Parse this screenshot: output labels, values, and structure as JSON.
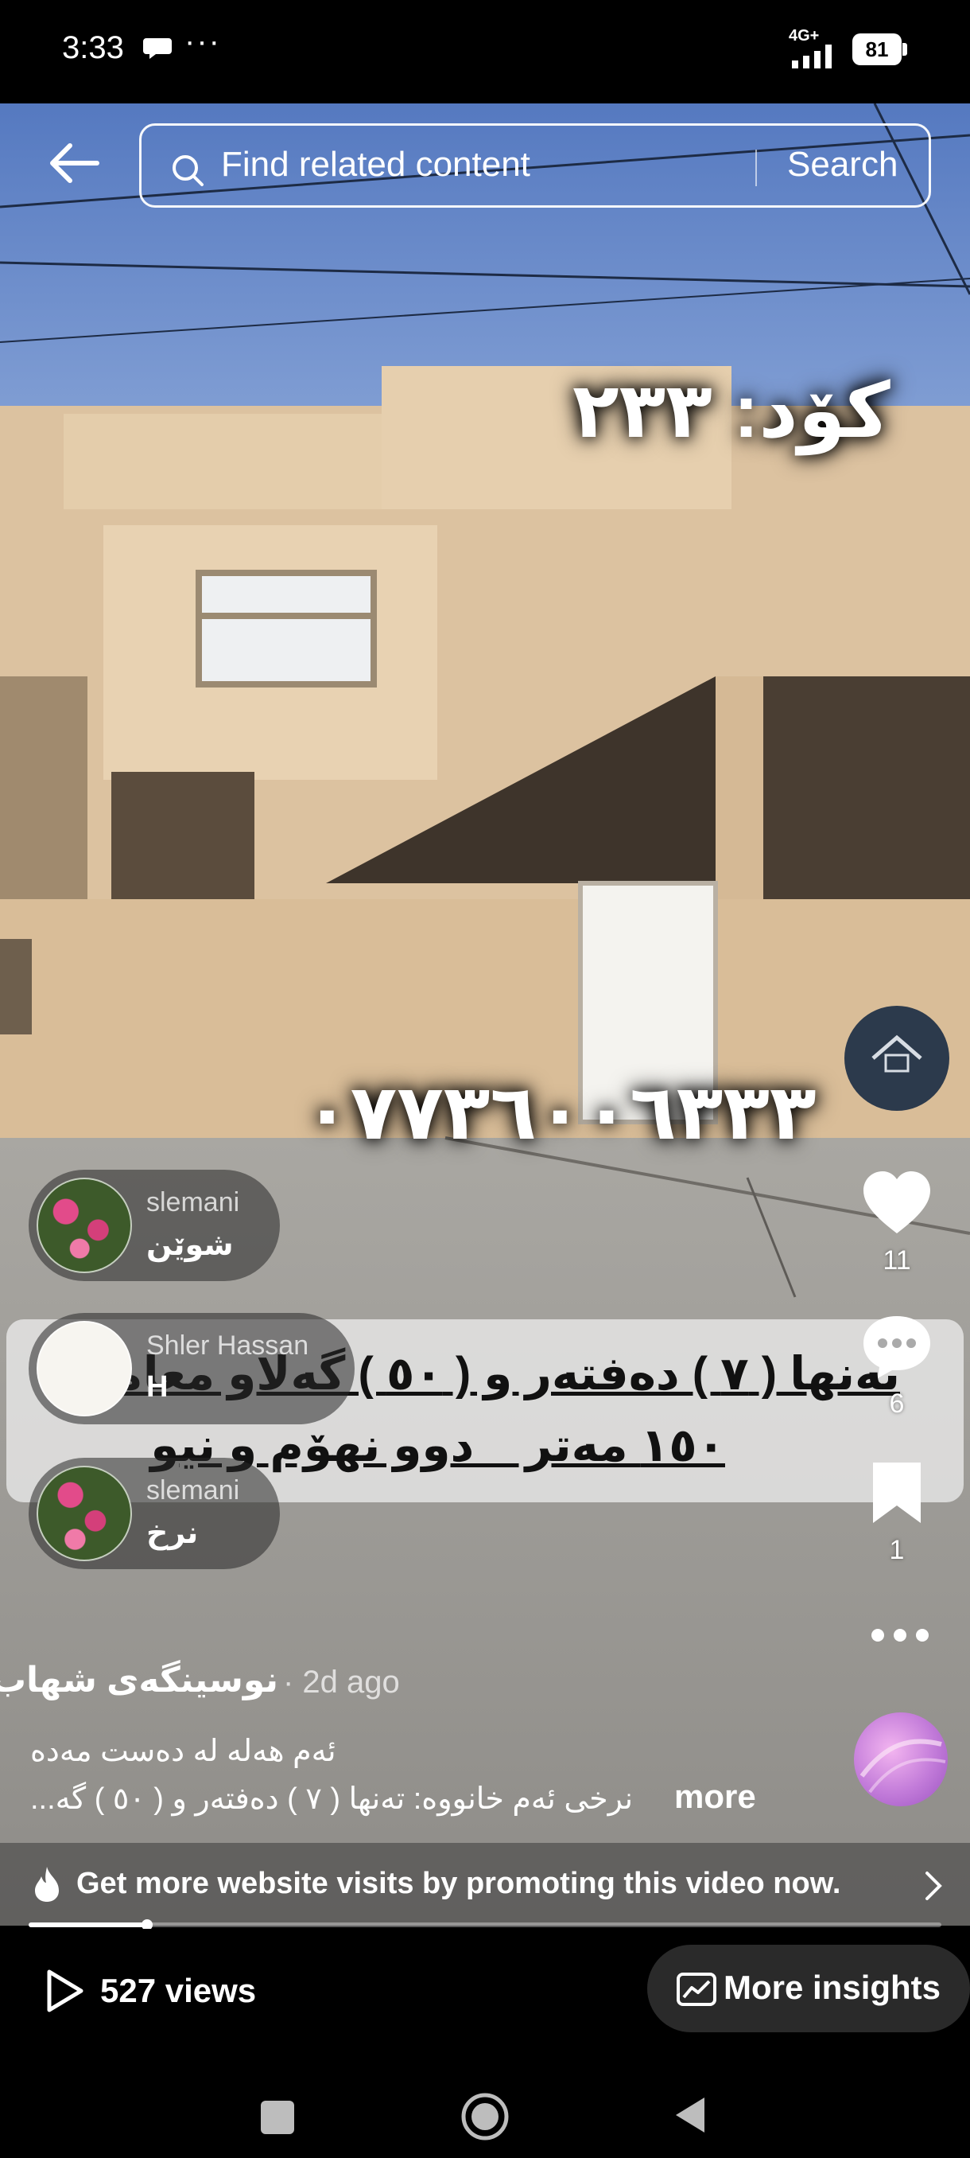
{
  "status_bar": {
    "time": "3:33",
    "more_indicator": "···",
    "network": "4G+",
    "battery": "81"
  },
  "search": {
    "placeholder": "Find related content",
    "button_label": "Search"
  },
  "video_overlay": {
    "code": "کۆد: ٢٣٣",
    "phone": "٠٧٧٣٦٠٠٦٣٣٣",
    "price_line1": "تەنها ( ٧ ) دەفتەر و ( ٥٠ ) گەلاو معاملە",
    "price_line2": "١٥٠ مەتر _ دوو نهۆم و نیو"
  },
  "comments": [
    {
      "user": "slemani",
      "text": "شوێن"
    },
    {
      "user": "Shler Hassan",
      "text": "H"
    },
    {
      "user": "slemani",
      "text": "نرخ"
    }
  ],
  "rail": {
    "likes": "11",
    "comments": "6",
    "saves": "1"
  },
  "caption": {
    "author": "نوسینگەی شهاب",
    "time": "· 2d ago",
    "line1": "ئەم هەلە لە دەست مەدە",
    "line2": "نرخی ئەم خانووە: تەنها ( ٧ ) دەفتەر و ( ٥٠ ) گە...",
    "more_label": "more"
  },
  "promote": {
    "text": "Get more website visits by promoting this video now."
  },
  "progress": {
    "fraction": 0.13
  },
  "bottom": {
    "views": "527 views",
    "insights_label": "More insights"
  },
  "colors": {
    "sky": "#5a7fc4",
    "wall": "#e2c7a3",
    "street": "#b9b5ae",
    "disc": "#d08ce0"
  }
}
